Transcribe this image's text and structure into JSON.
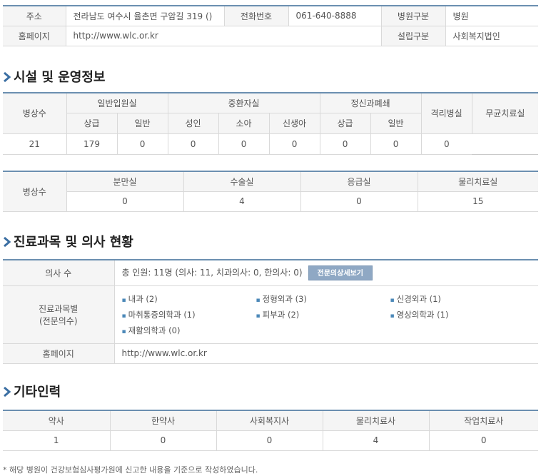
{
  "info": {
    "address_label": "주소",
    "address_value": "전라남도 여수시 율촌면 구암길 319 ()",
    "phone_label": "전화번호",
    "phone_value": "061-640-8888",
    "type_label": "병원구분",
    "type_value": "병원",
    "homepage_label": "홈페이지",
    "homepage_value": "http://www.wlc.or.kr",
    "founder_label": "설립구분",
    "founder_value": "사회복지법인"
  },
  "facility": {
    "title": "시설 및 운영정보",
    "row_label": "병상수",
    "groups": {
      "general": "일반입원실",
      "icu": "중환자실",
      "psych": "정신과폐쇄",
      "isolation": "격리병실",
      "sterile": "무균치료실"
    },
    "subheads": [
      "상급",
      "일반",
      "성인",
      "소아",
      "신생아",
      "상급",
      "일반"
    ],
    "values": [
      "21",
      "179",
      "0",
      "0",
      "0",
      "0",
      "0",
      "0",
      "0"
    ],
    "row2_label": "병상수",
    "row2_heads": [
      "분만실",
      "수술실",
      "응급실",
      "물리치료실"
    ],
    "row2_values": [
      "0",
      "4",
      "0",
      "15"
    ]
  },
  "doctors": {
    "title": "진료과목 및 의사 현황",
    "count_label": "의사 수",
    "count_value": "총 인원: 11명 (의사: 11, 치과의사: 0, 한의사: 0)",
    "detail_button": "전문의상세보기",
    "dept_label_1": "진료과목별",
    "dept_label_2": "(전문의수)",
    "departments": [
      "내과 (2)",
      "정형외과 (3)",
      "신경외과 (1)",
      "마취통증의학과 (1)",
      "피부과 (2)",
      "영상의학과 (1)",
      "재활의학과 (0)"
    ],
    "homepage_label": "홈페이지",
    "homepage_value": "http://www.wlc.or.kr"
  },
  "staff": {
    "title": "기타인력",
    "heads": [
      "약사",
      "한약사",
      "사회복지사",
      "물리치료사",
      "작업치료사"
    ],
    "values": [
      "1",
      "0",
      "0",
      "4",
      "0"
    ]
  },
  "footnote": "* 해당 병원이 건강보험심사평가원에 신고한 내용을 기준으로 작성하였습니다.",
  "colors": {
    "accent": "#6b8fb0",
    "button": "#8fa8c4",
    "header_bg": "#f5f5f5",
    "bullet": "#4b88b8"
  }
}
